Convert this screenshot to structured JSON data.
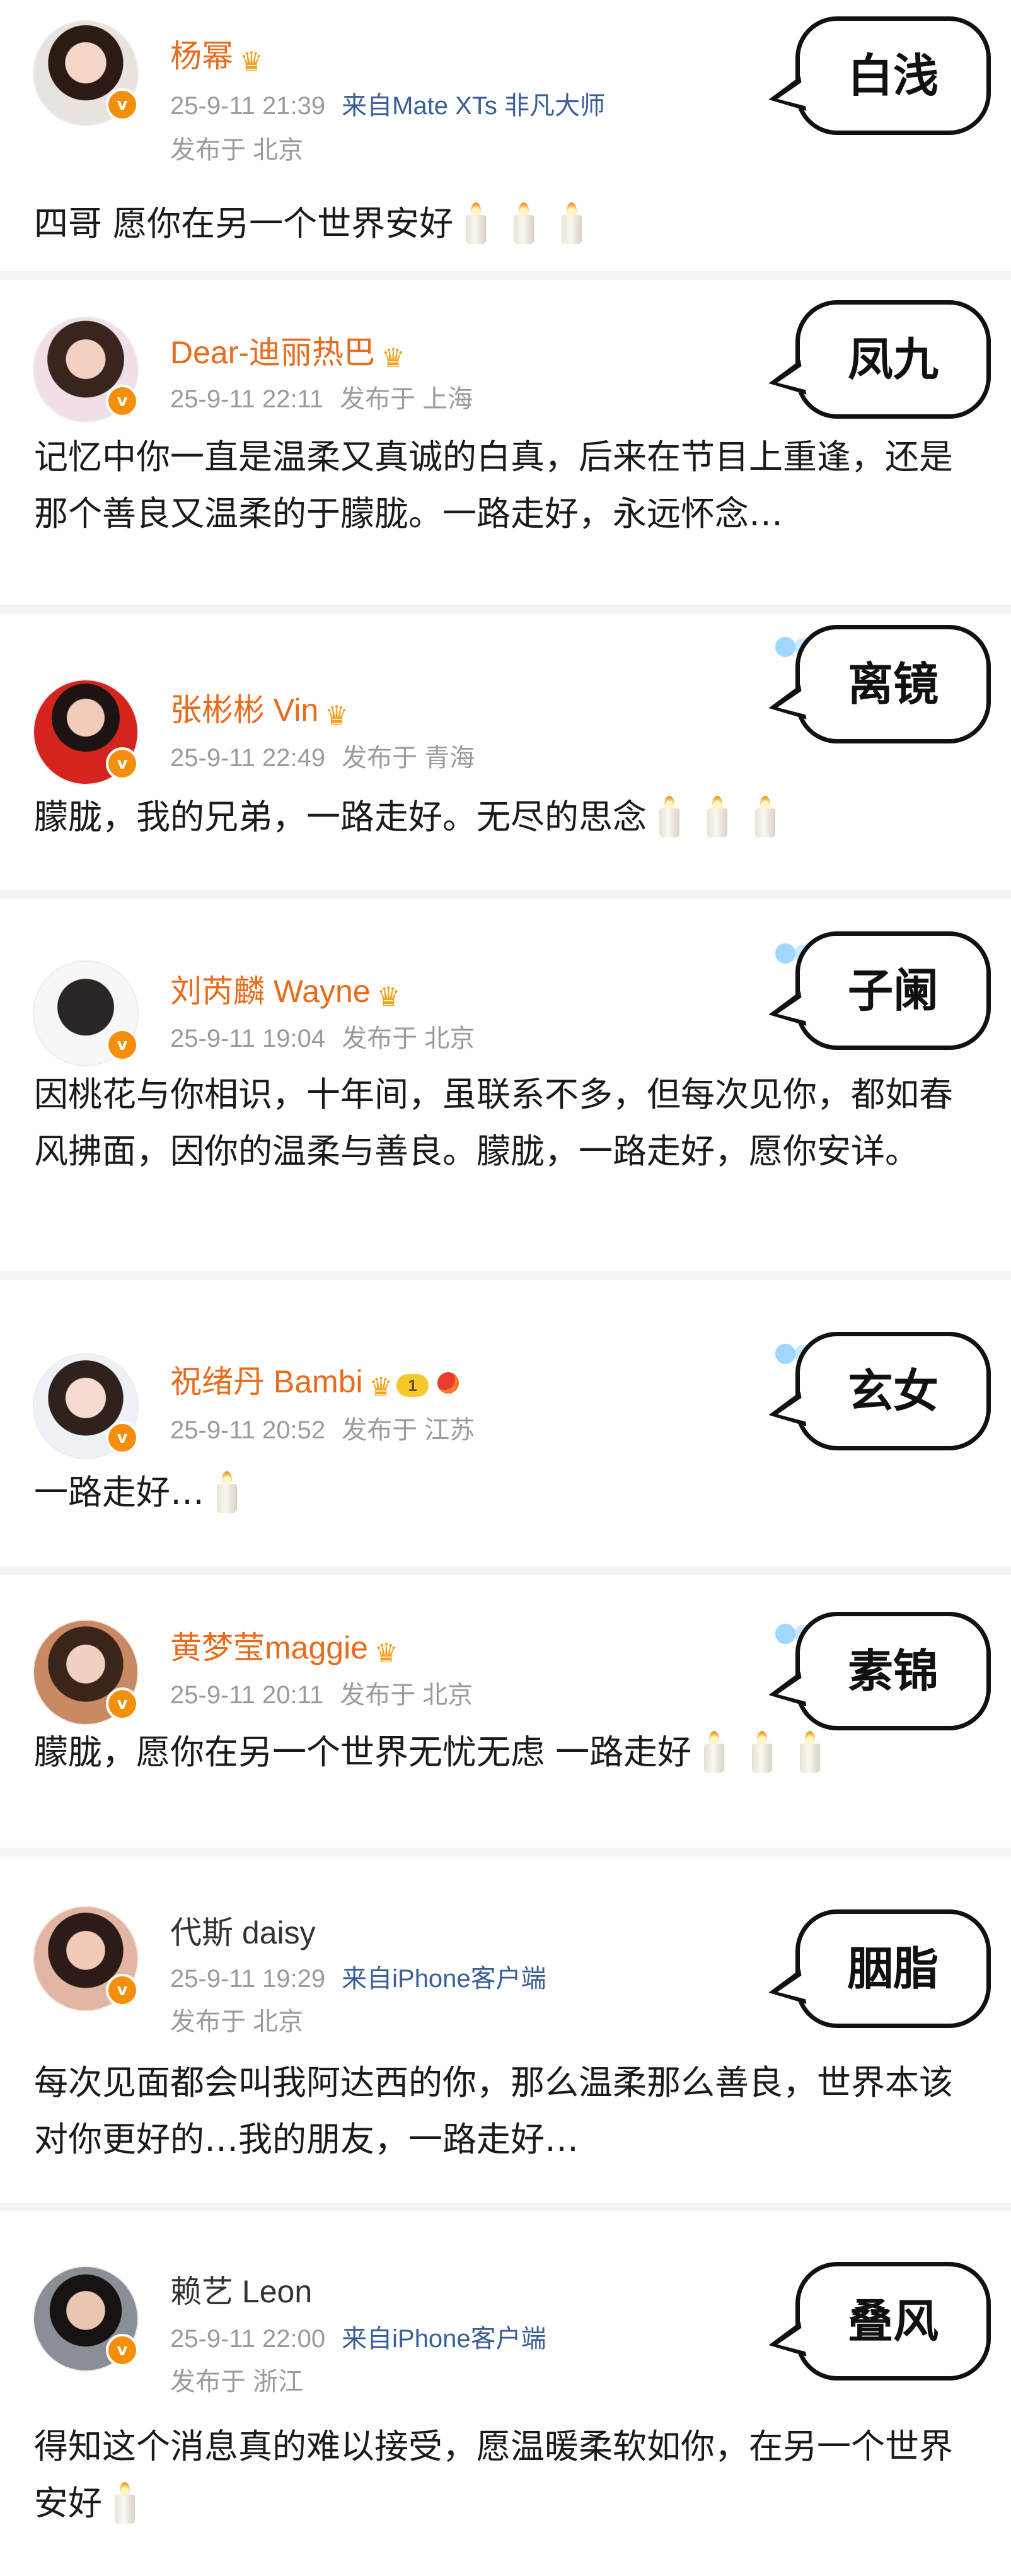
{
  "colors": {
    "name_vip": "#e86b1b",
    "verified_badge": "#f58e0a",
    "meta_gray": "#9b9b9b",
    "source_link": "#3a5e97"
  },
  "posts": [
    {
      "author": "杨幂",
      "datetime": "25-9-11 21:39",
      "source": "来自Mate XTs 非凡大师",
      "location": "发布于 北京",
      "text": "四哥 愿你在另一个世界安好",
      "candles": 3,
      "role": "白浅",
      "vip_crown": true,
      "verified": "v"
    },
    {
      "author": "Dear-迪丽热巴",
      "datetime": "25-9-11 22:11",
      "source": "",
      "location": "发布于 上海",
      "text": "记忆中你一直是温柔又真诚的白真，后来在节目上重逢，还是那个善良又温柔的于朦胧。一路走好，永远怀念…",
      "candles": 0,
      "role": "凤九",
      "vip_crown": true,
      "verified": "v"
    },
    {
      "author": "张彬彬 Vin",
      "datetime": "25-9-11 22:49",
      "source": "",
      "location": "发布于 青海",
      "text": "朦胧，我的兄弟，一路走好。无尽的思念",
      "candles": 3,
      "role": "离镜",
      "vip_crown": true,
      "verified": "v"
    },
    {
      "author": "刘芮麟 Wayne",
      "datetime": "25-9-11 19:04",
      "source": "",
      "location": "发布于 北京",
      "text": "因桃花与你相识，十年间，虽联系不多，但每次见你，都如春风拂面，因你的温柔与善良。朦胧，一路走好，愿你安详。",
      "candles": 0,
      "role": "子阑",
      "vip_crown": true,
      "verified": "v"
    },
    {
      "author": "祝绪丹 Bambi",
      "datetime": "25-9-11 20:52",
      "source": "",
      "location": "发布于 江苏",
      "text": "一路走好…",
      "candles": 1,
      "role": "玄女",
      "vip_crown": true,
      "level_badge": "1",
      "verified": "v"
    },
    {
      "author": "黄梦莹maggie",
      "datetime": "25-9-11 20:11",
      "source": "",
      "location": "发布于 北京",
      "text": "朦胧，愿你在另一个世界无忧无虑 一路走好",
      "candles": 3,
      "role": "素锦",
      "vip_crown": true,
      "verified": "v"
    },
    {
      "author": "代斯 daisy",
      "datetime": "25-9-11 19:29",
      "source": "来自iPhone客户端",
      "location": "发布于 北京",
      "text": "每次见面都会叫我阿达西的你，那么温柔那么善良，世界本该对你更好的…我的朋友，一路走好…",
      "candles": 0,
      "role": "胭脂",
      "vip_crown": false,
      "verified": "v"
    },
    {
      "author": "赖艺 Leon",
      "datetime": "25-9-11 22:00",
      "source": "来自iPhone客户端",
      "location": "发布于 浙江",
      "text": "得知这个消息真的难以接受，愿温暖柔软如你，在另一个世界安好",
      "candles": 1,
      "role": "叠风",
      "vip_crown": false,
      "verified": "v"
    }
  ]
}
